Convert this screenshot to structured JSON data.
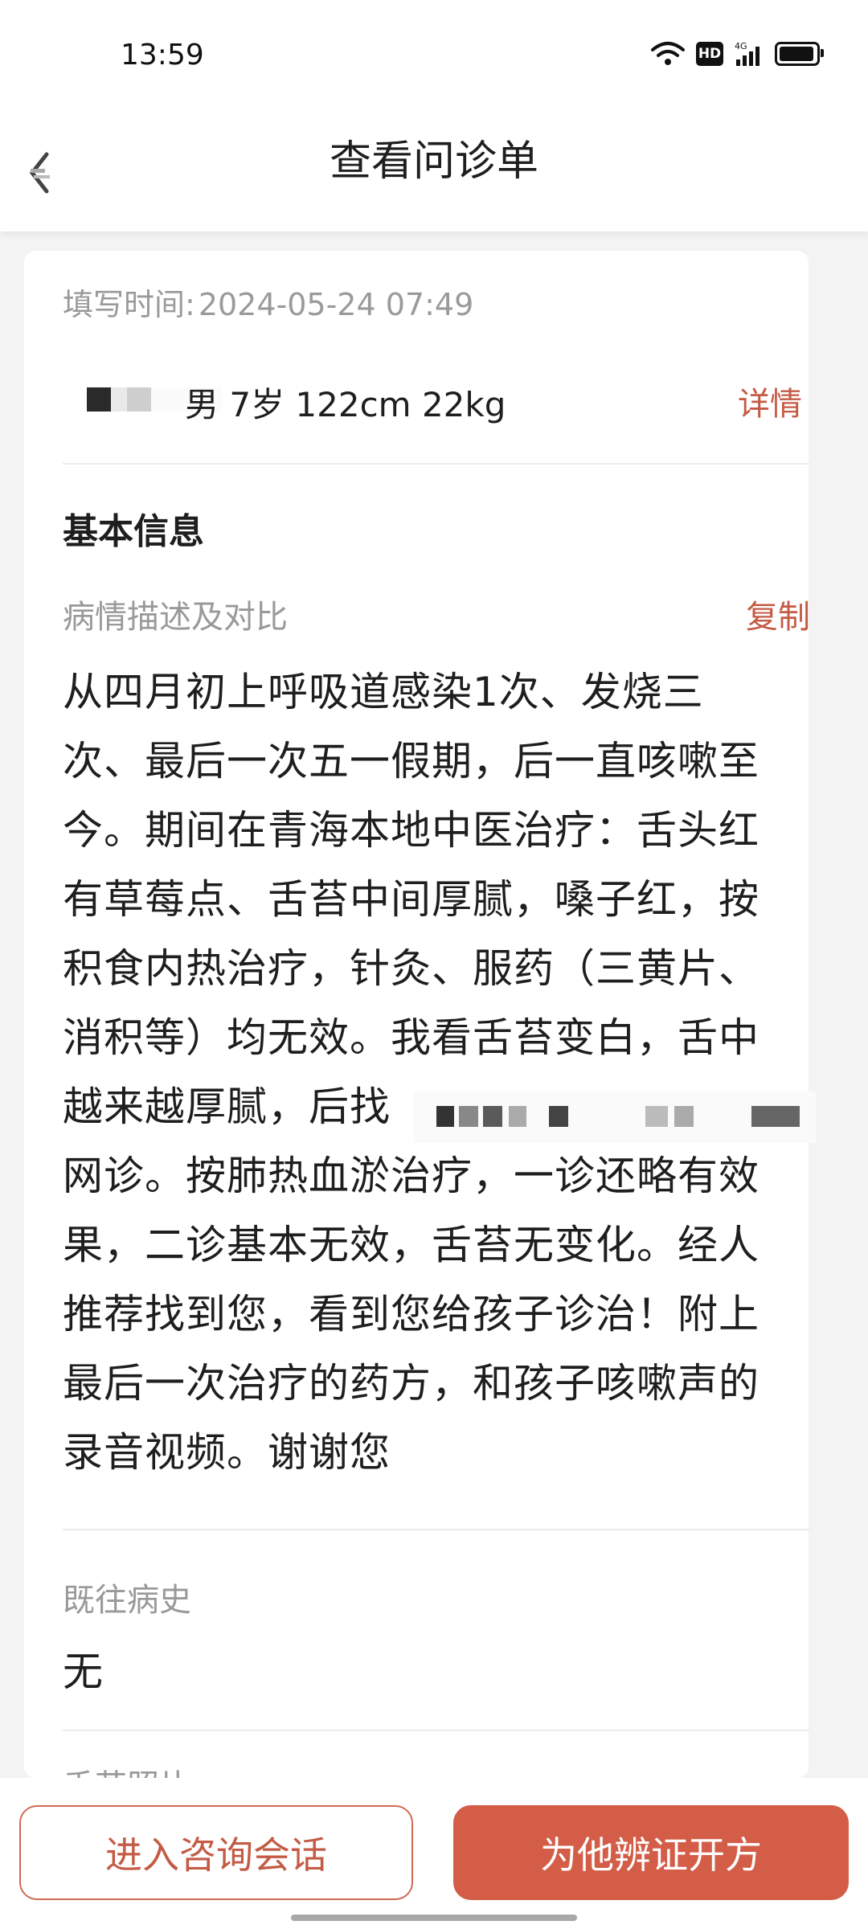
{
  "status_bar": {
    "time": "13:59",
    "network": "4G",
    "hd_badge": "HD",
    "icons": [
      "wifi-icon",
      "hd-icon",
      "signal-icon",
      "battery-icon"
    ]
  },
  "header": {
    "title": "查看问诊单",
    "back_icon": "back-arrow-icon"
  },
  "form": {
    "fill_time_label": "填写时间:",
    "fill_time_value": "2024-05-24 07:49",
    "patient_info": "男 7岁 122cm 22kg",
    "detail_link": "详情",
    "section_basic": "基本信息",
    "desc_label": "病情描述及对比",
    "copy_link": "复制",
    "description_lines": [
      "从四月初上呼吸道感染1次、发烧三",
      "次、最后一次五一假期，后一直咳嗽至",
      "今。期间在青海本地中医治疗：舌头红",
      "有草莓点、舌苔中间厚腻，嗓子红，按",
      "积食内热治疗，针灸、服药（三黄片、",
      "消积等）均无效。我看舌苔变白，舌中",
      "越来越厚腻，后找",
      "网诊。按肺热血淤治疗，一诊还略有效",
      "果，二诊基本无效，舌苔无变化。经人",
      "推荐找到您，看到您给孩子诊治！附上",
      "最后一次治疗的药方，和孩子咳嗽声的",
      "录音视频。谢谢您"
    ],
    "history_label": "既往病史",
    "history_value": "无",
    "tongue_label": "舌苔照片"
  },
  "actions": {
    "consult_label": "进入咨询会话",
    "prescribe_label": "为他辨证开方"
  },
  "colors": {
    "accent": "#c45b45",
    "primary_button": "#d45d48",
    "background": "#f4f3f3"
  }
}
